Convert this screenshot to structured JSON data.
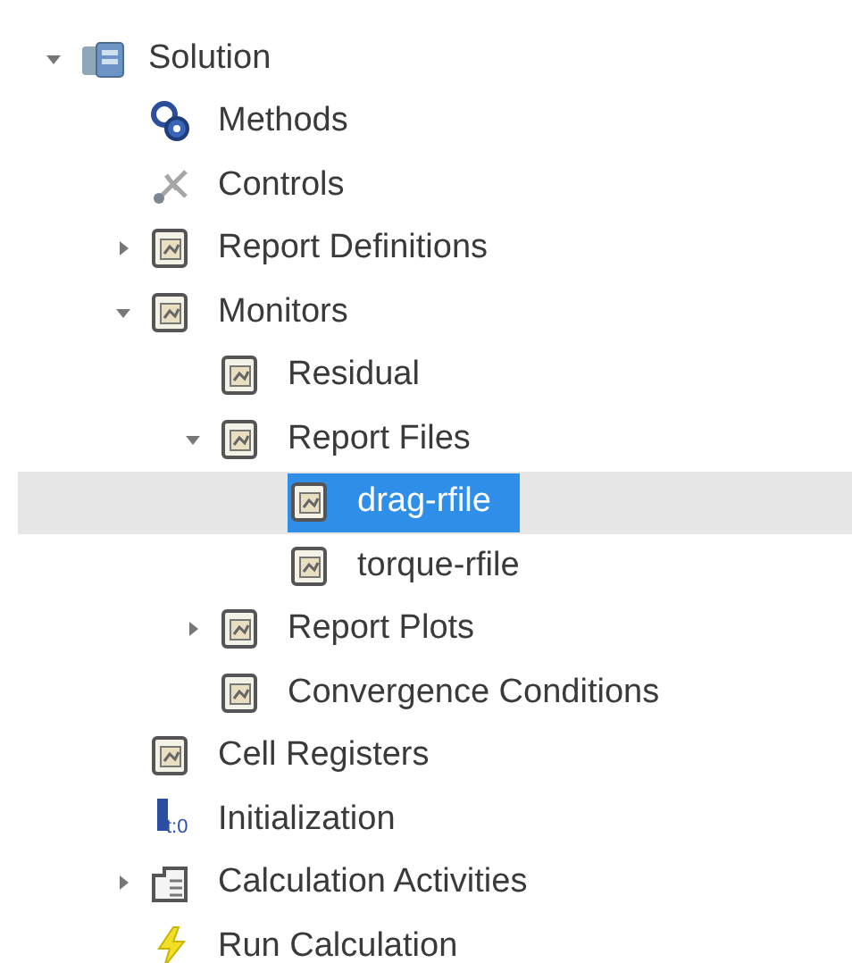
{
  "tree": [
    {
      "label": "Solution",
      "kind": "solution",
      "expanded": true,
      "selected": false,
      "children": [
        {
          "label": "Methods",
          "kind": "methods",
          "selected": false
        },
        {
          "label": "Controls",
          "kind": "controls",
          "selected": false
        },
        {
          "label": "Report Definitions",
          "kind": "document",
          "expanded": false,
          "selected": false
        },
        {
          "label": "Monitors",
          "kind": "document",
          "expanded": true,
          "selected": false,
          "children": [
            {
              "label": "Residual",
              "kind": "document",
              "selected": false
            },
            {
              "label": "Report Files",
              "kind": "document",
              "expanded": true,
              "selected": false,
              "children": [
                {
                  "label": "drag-rfile",
                  "kind": "document",
                  "selected": true
                },
                {
                  "label": "torque-rfile",
                  "kind": "document",
                  "selected": false
                }
              ]
            },
            {
              "label": "Report Plots",
              "kind": "document",
              "expanded": false,
              "selected": false
            },
            {
              "label": "Convergence Conditions",
              "kind": "document",
              "selected": false
            }
          ]
        },
        {
          "label": "Cell Registers",
          "kind": "document",
          "selected": false
        },
        {
          "label": "Initialization",
          "kind": "initialization",
          "icon_text": "t:0",
          "selected": false
        },
        {
          "label": "Calculation Activities",
          "kind": "activities",
          "expanded": false,
          "selected": false
        },
        {
          "label": "Run Calculation",
          "kind": "run",
          "selected": false
        }
      ]
    }
  ]
}
